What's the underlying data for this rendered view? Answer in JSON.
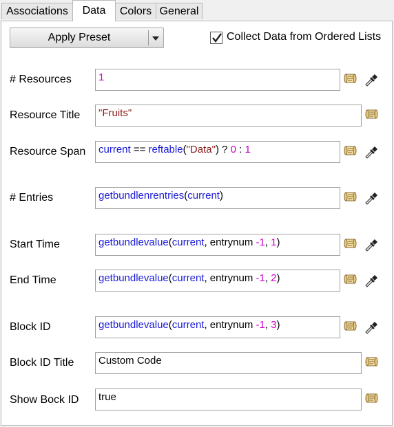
{
  "tabs": [
    {
      "label": "Associations"
    },
    {
      "label": "Data"
    },
    {
      "label": "Colors"
    },
    {
      "label": "General"
    }
  ],
  "preset": {
    "label": "Apply Preset"
  },
  "collect": {
    "label": "Collect Data from Ordered Lists",
    "checked": true
  },
  "rows": {
    "resources": {
      "label": "# Resources",
      "value": "1"
    },
    "resource_title": {
      "label": "Resource Title",
      "value": "\"Fruits\""
    },
    "resource_span": {
      "label": "Resource Span",
      "t1": "current",
      "t2": " == ",
      "t3": "reftable",
      "t4": "(",
      "t5": "\"Data\"",
      "t6": ") ? ",
      "t7": "0",
      "t8": " : ",
      "t9": "1"
    },
    "entries": {
      "label": "# Entries",
      "t1": "getbundlenrentries",
      "t2": "(",
      "t3": "current",
      "t4": ")"
    },
    "start_time": {
      "label": "Start Time",
      "t1": "getbundlevalue",
      "t2": "(",
      "t3": "current",
      "t4": ", entrynum ",
      "t5": "-1",
      "t6": ", ",
      "t7": "1",
      "t8": ")"
    },
    "end_time": {
      "label": "End Time",
      "t1": "getbundlevalue",
      "t2": "(",
      "t3": "current",
      "t4": ", entrynum ",
      "t5": "-1",
      "t6": ", ",
      "t7": "2",
      "t8": ")"
    },
    "block_id": {
      "label": "Block ID",
      "t1": "getbundlevalue",
      "t2": "(",
      "t3": "current",
      "t4": ", entrynum ",
      "t5": "-1",
      "t6": ", ",
      "t7": "3",
      "t8": ")"
    },
    "block_id_title": {
      "label": "Block ID Title",
      "value": "Custom Code"
    },
    "show_block_id": {
      "label": "Show Bock ID",
      "value": "true"
    }
  },
  "icons": {
    "scroll": "code-scroll-icon",
    "dropper": "eyedropper-icon"
  },
  "colors": {
    "keyword": "#1a1ad6",
    "number": "#cc00cc",
    "string": "#8b1a1a"
  }
}
